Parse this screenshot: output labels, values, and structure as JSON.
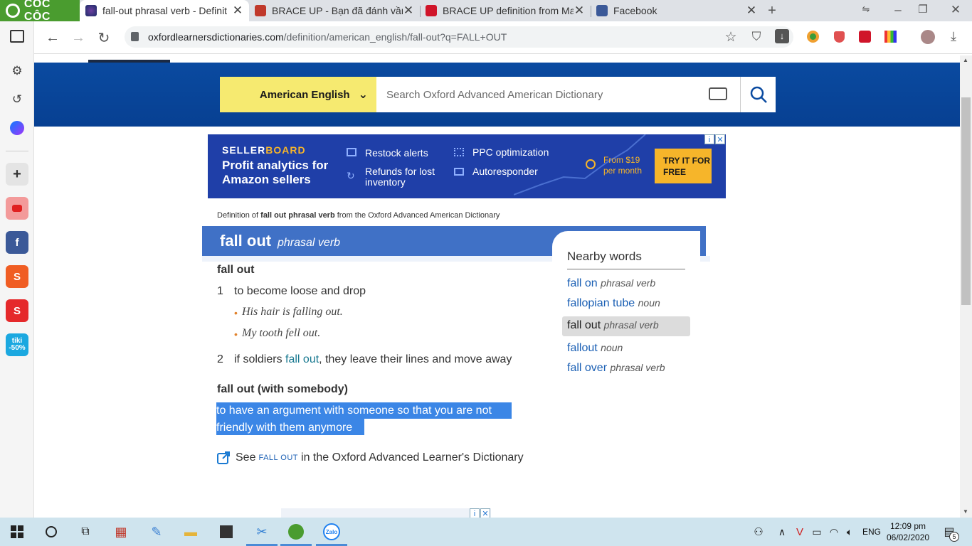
{
  "browser": {
    "brand_label": "CÔC CÔC",
    "tabs": [
      {
        "title": "fall-out phrasal verb - Definit",
        "active": true
      },
      {
        "title": "BRACE UP - Bạn đã đánh vần",
        "active": false
      },
      {
        "title": "BRACE UP definition from Ma",
        "active": false
      },
      {
        "title": "Facebook",
        "active": false
      }
    ],
    "new_tab_icon": "plus-icon",
    "url_host": "oxfordlearnersdictionaries.com",
    "url_path": "/definition/american_english/fall-out?q=FALL+OUT"
  },
  "site": {
    "dictionary_select": "American English",
    "search_placeholder": "Search Oxford Advanced American Dictionary",
    "accent": "#0a4aa0",
    "yellow": "#f6ea70"
  },
  "ad": {
    "brand_a": "SELLER",
    "brand_b": "BOARD",
    "headline": "Profit analytics for Amazon sellers",
    "feat1": "Restock alerts",
    "feat2": "Refunds for lost inventory",
    "feat3": "PPC optimization",
    "feat4": "Autoresponder",
    "price": "From $19 per month",
    "cta": "TRY IT FOR FREE"
  },
  "entry": {
    "source_pre": "Definition of ",
    "source_bold": "fall out phrasal verb",
    "source_post": " from the Oxford Advanced American Dictionary",
    "headword": "fall out",
    "pos": "phrasal verb",
    "sense_group1": "fall out",
    "sense1_num": "1",
    "sense1": "to become loose and drop",
    "ex1": "His hair is falling out.",
    "ex2": "My tooth fell out.",
    "sense2_num": "2",
    "sense2_pre": "if soldiers ",
    "sense2_link": "fall out",
    "sense2_post": ", they leave their lines and move away",
    "sense_group2": "fall out (with somebody)",
    "sense3_line1": "to have an argument with someone so that you are not",
    "sense3_line2": "friendly with them anymore",
    "see_pre": "See",
    "see_word": "FALL OUT",
    "see_post": "in the Oxford Advanced Learner's Dictionary"
  },
  "nearby": {
    "title": "Nearby words",
    "items": [
      {
        "word": "fall on",
        "pos": "phrasal verb"
      },
      {
        "word": "fallopian tube",
        "pos": "noun"
      },
      {
        "word": "fall out",
        "pos": "phrasal verb"
      },
      {
        "word": "fallout",
        "pos": "noun"
      },
      {
        "word": "fall over",
        "pos": "phrasal verb"
      }
    ]
  },
  "taskbar": {
    "language": "ENG",
    "time": "12:09 pm",
    "date": "06/02/2020",
    "notification_count": "5"
  }
}
